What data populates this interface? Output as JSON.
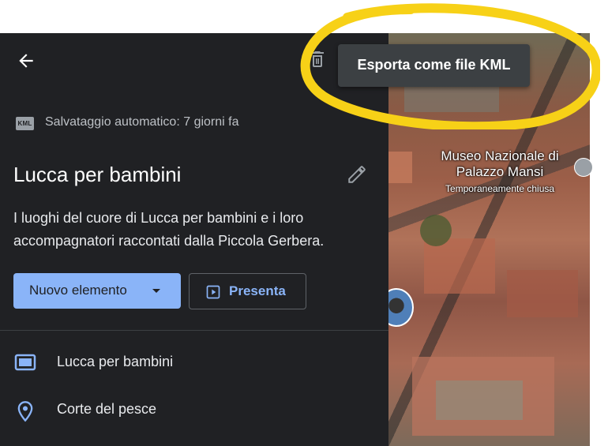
{
  "tooltip": {
    "text": "Esporta come file KML"
  },
  "header": {
    "back_icon": "arrow-back-icon",
    "delete_icon": "delete-icon",
    "kml_badge": "KML",
    "autosave": "Salvataggio automatico: 7 giorni fa"
  },
  "map_info": {
    "title": "Lucca per bambini",
    "description": "I luoghi del cuore di Lucca per bambini e i loro accompagnatori raccontati dalla Piccola Gerbera."
  },
  "buttons": {
    "new_item": "Nuovo elemento",
    "present": "Presenta"
  },
  "layers": [
    {
      "label": "Lucca per bambini",
      "icon": "layer-icon"
    },
    {
      "label": "Corte del pesce",
      "icon": "place-pin-icon"
    }
  ],
  "map_labels": {
    "poi_name": "Museo Nazionale di Palazzo Mansi",
    "poi_status": "Temporaneamente chiusa"
  },
  "colors": {
    "panel_bg": "#202124",
    "accent": "#8ab4f8",
    "highlight": "#f7d117"
  }
}
